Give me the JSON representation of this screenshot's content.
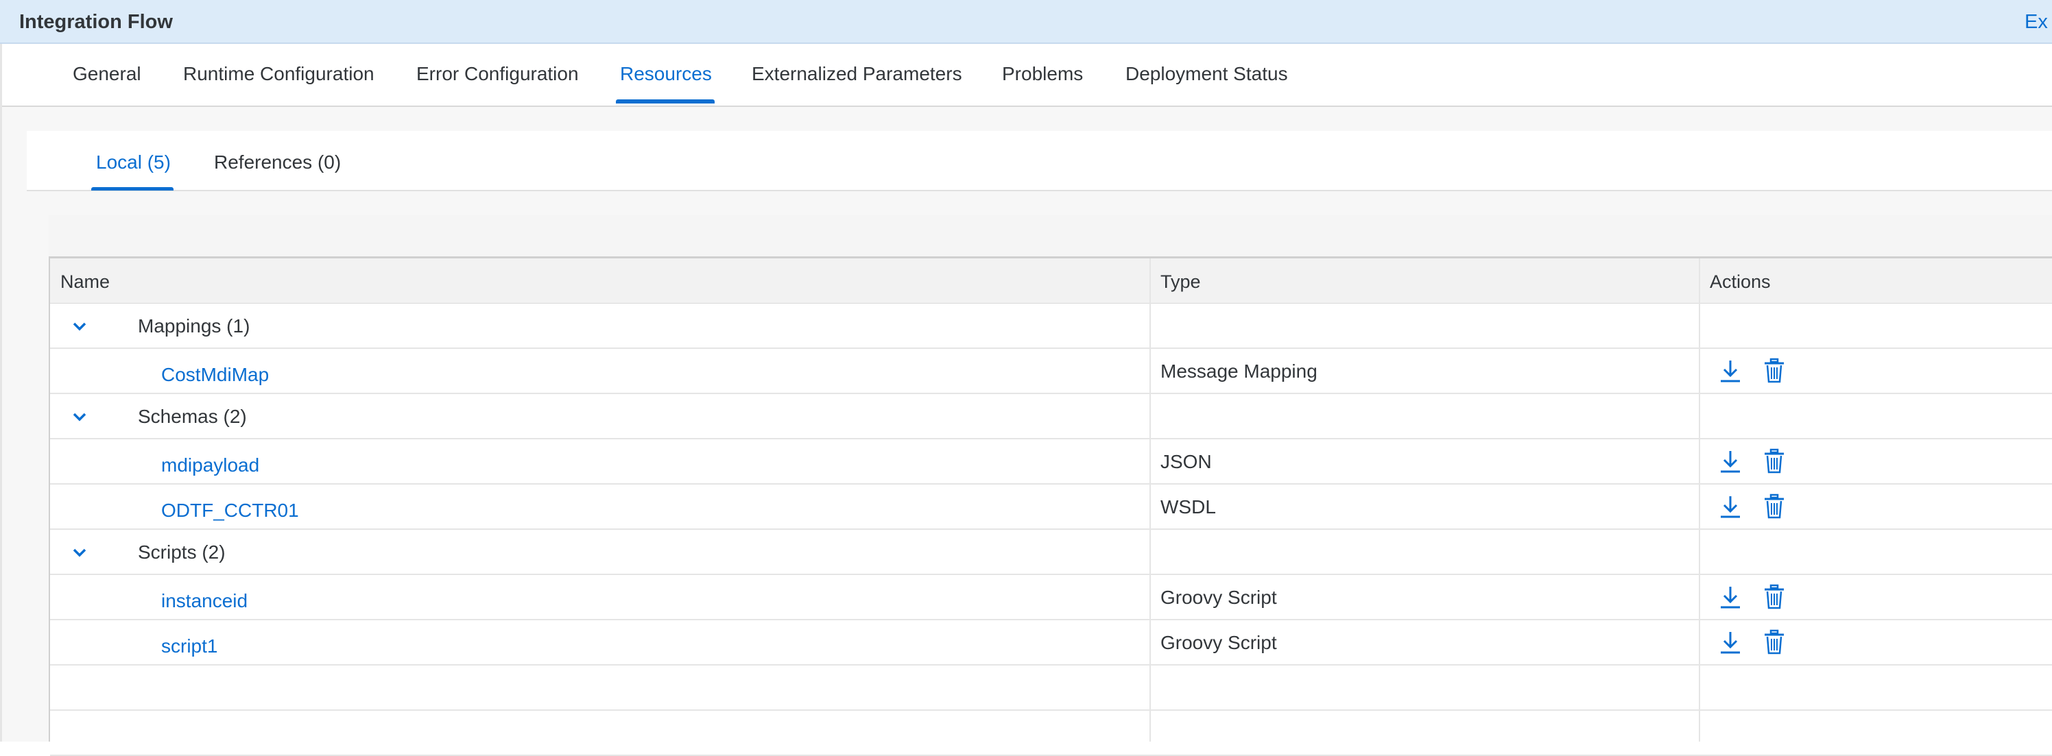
{
  "header": {
    "title": "Integration Flow",
    "expand_label": "Ex"
  },
  "main_tabs": [
    {
      "label": "General",
      "active": false
    },
    {
      "label": "Runtime Configuration",
      "active": false
    },
    {
      "label": "Error Configuration",
      "active": false
    },
    {
      "label": "Resources",
      "active": true
    },
    {
      "label": "Externalized Parameters",
      "active": false
    },
    {
      "label": "Problems",
      "active": false
    },
    {
      "label": "Deployment Status",
      "active": false
    }
  ],
  "sub_tabs": [
    {
      "label": "Local (5)",
      "active": true
    },
    {
      "label": "References (0)",
      "active": false
    }
  ],
  "table": {
    "columns": [
      "Name",
      "Type",
      "Actions"
    ],
    "groups": [
      {
        "label": "Mappings (1)",
        "expanded": true,
        "items": [
          {
            "name": "CostMdiMap",
            "type": "Message Mapping"
          }
        ]
      },
      {
        "label": "Schemas (2)",
        "expanded": true,
        "items": [
          {
            "name": "mdipayload",
            "type": "JSON"
          },
          {
            "name": "ODTF_CCTR01",
            "type": "WSDL"
          }
        ]
      },
      {
        "label": "Scripts (2)",
        "expanded": true,
        "items": [
          {
            "name": "instanceid",
            "type": "Groovy Script"
          },
          {
            "name": "script1",
            "type": "Groovy Script"
          }
        ]
      }
    ],
    "actions": {
      "download_icon": "download-icon",
      "delete_icon": "trash-icon"
    }
  },
  "colors": {
    "accent": "#0a6ed1",
    "title_bar": "#dcebf9",
    "text": "#32363a"
  }
}
